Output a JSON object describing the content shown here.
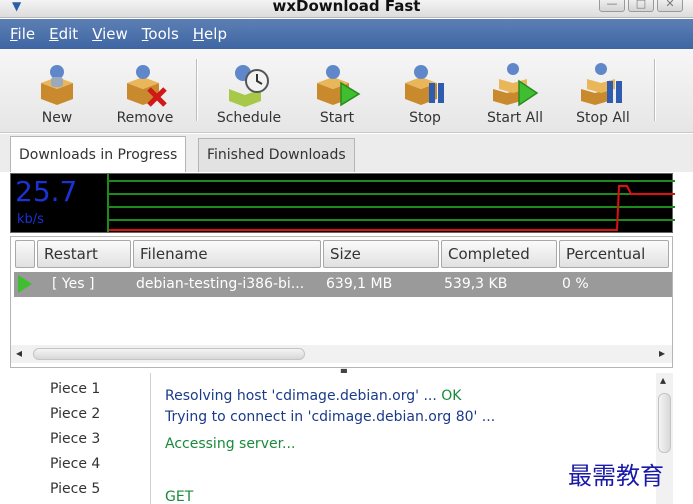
{
  "window": {
    "title": "wxDownload Fast"
  },
  "menu": [
    {
      "label": "File",
      "mnemonic": "F",
      "rest": "ile"
    },
    {
      "label": "Edit",
      "mnemonic": "E",
      "rest": "dit"
    },
    {
      "label": "View",
      "mnemonic": "V",
      "rest": "iew"
    },
    {
      "label": "Tools",
      "mnemonic": "T",
      "rest": "ools"
    },
    {
      "label": "Help",
      "mnemonic": "H",
      "rest": "elp"
    }
  ],
  "toolbar": {
    "new": "New",
    "remove": "Remove",
    "schedule": "Schedule",
    "start": "Start",
    "stop": "Stop",
    "start_all": "Start All",
    "stop_all": "Stop All"
  },
  "tabs": {
    "in_progress": "Downloads in Progress",
    "finished": "Finished Downloads"
  },
  "graph": {
    "speed": "25.7",
    "unit": "kb/s",
    "line_color": "#e01010",
    "grid_color": "#1c8a1c"
  },
  "list": {
    "columns": [
      "Restart",
      "Filename",
      "Size",
      "Completed",
      "Percentual"
    ],
    "rows": [
      {
        "restart": "[ Yes ]",
        "filename": "debian-testing-i386-bi...",
        "size": "639,1 MB",
        "completed": "539,3 KB",
        "percentual": "0 %"
      }
    ]
  },
  "pieces": [
    "Piece 1",
    "Piece 2",
    "Piece 3",
    "Piece 4",
    "Piece 5"
  ],
  "log": [
    {
      "prefix": "Resolving host 'cdimage.debian.org' ... ",
      "status": "OK"
    },
    {
      "prefix": "Trying to connect in 'cdimage.debian.org 80' ...",
      "status": ""
    },
    {
      "prefix": "Accessing server...",
      "status": ""
    },
    {
      "prefix": "GET",
      "status": ""
    }
  ],
  "colors": {
    "menubar": "#4a6fa9",
    "log_green": "#1a8a3a",
    "log_blue": "#1a3a8a"
  },
  "watermark": "最需教育"
}
